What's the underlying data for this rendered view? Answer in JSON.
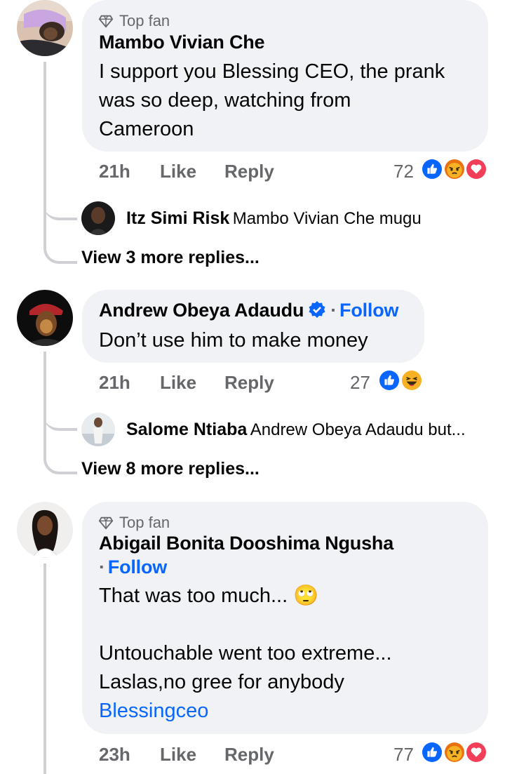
{
  "comments": [
    {
      "badge": "Top fan",
      "author": "Mambo Vivian Che",
      "text_lines": [
        "I support you Blessing CEO, the prank",
        "was so deep, watching from",
        "Cameroon"
      ],
      "time": "21h",
      "like_label": "Like",
      "reply_label": "Reply",
      "reaction_count": "72",
      "reactions": [
        "like-icon",
        "angry-icon",
        "love-icon"
      ],
      "reply_preview": {
        "author": "Itz Simi Risk",
        "text": "Mambo Vivian Che mugu"
      },
      "view_more": "View 3 more replies..."
    },
    {
      "author": "Andrew Obeya Adaudu",
      "verified": true,
      "follow_label": "Follow",
      "follow_dot": "·",
      "text_lines": [
        "Don’t use him to make money"
      ],
      "time": "21h",
      "like_label": "Like",
      "reply_label": "Reply",
      "reaction_count": "27",
      "reactions": [
        "like-icon",
        "haha-icon"
      ],
      "reply_preview": {
        "author": "Salome Ntiaba",
        "text": "Andrew Obeya Adaudu but..."
      },
      "view_more": "View 8 more replies..."
    },
    {
      "badge": "Top fan",
      "author": "Abigail Bonita Dooshima Ngusha",
      "follow_label": "Follow",
      "follow_dot": "·",
      "text_lines": [
        "That was too much... ",
        "",
        "Untouchable went too extreme...",
        "Laslas,no gree for anybody"
      ],
      "emoji": "🙄",
      "link": "Blessingceo",
      "time": "23h",
      "like_label": "Like",
      "reply_label": "Reply",
      "reaction_count": "77",
      "reactions": [
        "like-icon",
        "angry-icon",
        "love-icon"
      ]
    }
  ],
  "colors": {
    "bubble": "#f0f2f5",
    "link": "#0866ff",
    "meta": "#65676b",
    "thread": "#ced0d4"
  }
}
